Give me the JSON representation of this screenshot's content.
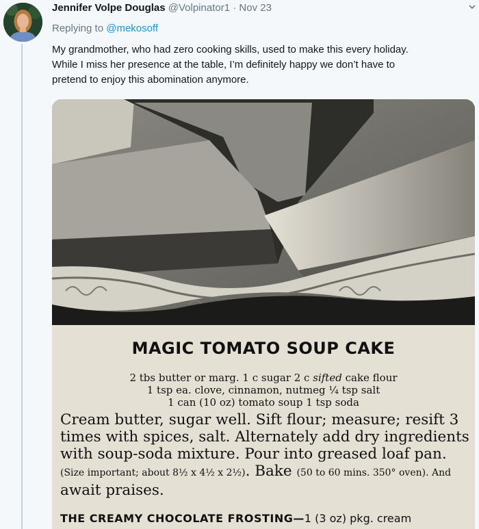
{
  "author": {
    "name": "Jennifer Volpe Douglas",
    "handle": "@Volpinator1",
    "separator": "·",
    "date": "Nov 23"
  },
  "reply": {
    "prefix": "Replying to",
    "to": "@mekosoff"
  },
  "tweet_text": [
    "My grandmother, who had zero cooking skills, used to make this every holiday.",
    "While I miss her presence at the table, I’m definitely happy we don’t have to",
    "pretend to enjoy this abomination anymore."
  ],
  "image": {
    "title": "MAGIC TOMATO SOUP CAKE",
    "ingredients": {
      "line1_a": "2 tbs butter or marg.      1 c sugar      2 c",
      "line1_sifted": "sifted",
      "line1_b": "cake flour",
      "line2": "1 tsp ea. clove, cinnamon, nutmeg      ¼ tsp salt",
      "line3": "1 can (10 oz) tomato soup      1 tsp soda"
    },
    "instructions": {
      "main": "Cream butter, sugar well. Sift flour; measure; resift 3 times with spices, salt. Alternately add dry ingredients with soup-soda mixture. Pour into greased loaf pan.",
      "size_note": "(Size important; about 8½ x 4½ x 2½)",
      "bake": ". Bake",
      "bake_note": "(50 to 60 mins. 350° oven)",
      "end_small": ". And",
      "end": "await praises."
    },
    "frosting": {
      "title": "THE CREAMY CHOCOLATE FROSTING—",
      "text": "1 (3 oz) pkg. cream"
    }
  },
  "colors": {
    "background": "#f5f8fa",
    "link": "#1b95e0",
    "muted": "#657786",
    "thread_line": "#c4cfd6"
  },
  "icons": [
    "chevron-down-icon",
    "avatar"
  ]
}
